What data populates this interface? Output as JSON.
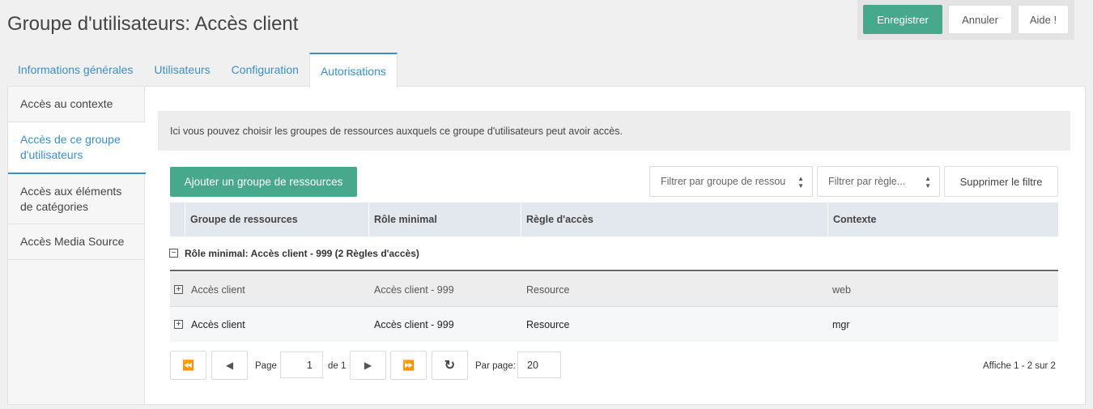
{
  "header": {
    "title": "Groupe d'utilisateurs: Accès client",
    "save_label": "Enregistrer",
    "cancel_label": "Annuler",
    "help_label": "Aide !"
  },
  "tabs": [
    {
      "label": "Informations générales"
    },
    {
      "label": "Utilisateurs"
    },
    {
      "label": "Configuration"
    },
    {
      "label": "Autorisations"
    }
  ],
  "vtabs": [
    {
      "label": "Accès au contexte"
    },
    {
      "label": "Accès de ce groupe d'utilisateurs"
    },
    {
      "label": "Accès aux éléments de catégories"
    },
    {
      "label": "Accès Media Source"
    }
  ],
  "main": {
    "description": "Ici vous pouvez choisir les groupes de ressources auxquels ce groupe d'utilisateurs peut avoir accès.",
    "add_button": "Ajouter un groupe de ressources",
    "filter_group_placeholder": "Filtrer par groupe de ressou",
    "filter_rule_placeholder": "Filtrer par règle...",
    "clear_filter": "Supprimer le filtre"
  },
  "grid": {
    "columns": [
      "Groupe de ressources",
      "Rôle minimal",
      "Règle d'accès",
      "Contexte"
    ],
    "group_label": "Rôle minimal: Accès client - 999 (2 Règles d'accès)",
    "rows": [
      {
        "group": "Accès client",
        "role": "Accès client - 999",
        "rule": "Resource",
        "context": "web"
      },
      {
        "group": "Accès client",
        "role": "Accès client - 999",
        "rule": "Resource",
        "context": "mgr"
      }
    ]
  },
  "pager": {
    "page_label": "Page",
    "page_value": "1",
    "of_label": "de 1",
    "per_page_label": "Par page:",
    "per_page_value": "20",
    "summary": "Affiche 1 - 2 sur 2"
  },
  "icons": {
    "first": "⏪",
    "prev": "◀",
    "next": "▶",
    "last": "⏩",
    "refresh": "↻",
    "collapse": "−",
    "expand": "+"
  },
  "colors": {
    "primary": "#48a88b",
    "link": "#3a8fc9"
  }
}
